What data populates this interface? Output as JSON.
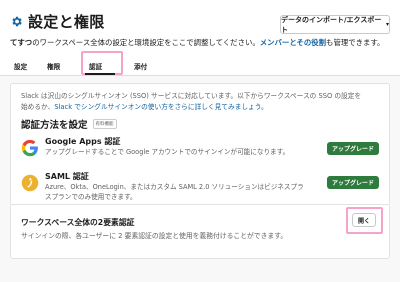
{
  "header": {
    "title": "設定と権限",
    "export_label": "データのインポート/エクスポート",
    "subtitle_workspace": "てすつ",
    "subtitle_text": "のワークスペース全体の設定と環境設定をここで調整してください。",
    "subtitle_link": "メンバーとその役割",
    "subtitle_tail": "も管理できます。"
  },
  "tabs": [
    {
      "label": "設定"
    },
    {
      "label": "権限"
    },
    {
      "label": "認証"
    },
    {
      "label": "添付"
    }
  ],
  "auth": {
    "intro_line1": "Slack は沢山のシングルサインオン (SSO) サービスに対応しています。以下からワークスペースの SSO の設定を",
    "intro_line2_prefix": "始めるか、",
    "intro_link": "Slack でシングルサインオンの使い方をさらに詳しく見てみましょう",
    "intro_line2_suffix": "。",
    "section_title": "認証方法を設定",
    "paid_badge": "有料機能",
    "methods": [
      {
        "name": "Google Apps 認証",
        "desc": "アップグレードすることで Google アカウントでのサインインが可能になります。",
        "button": "アップグレード",
        "icon": "google-icon"
      },
      {
        "name": "SAML 認証",
        "desc": "Azure、Okta、OneLogin、またはカスタム SAML 2.0 ソリューションはビジネスプラスプランでのみ使用できます。",
        "button": "アップグレード",
        "icon": "saml-icon"
      }
    ]
  },
  "two_factor": {
    "title": "ワークスペース全体の2要素認証",
    "desc": "サインインの際、各ユーザーに 2 要素認証の設定と使用を義務付けることができます。",
    "open_label": "開く"
  },
  "colors": {
    "accent_green": "#2f7b3d",
    "link_blue": "#1264a3",
    "highlight_pink": "#f5a3c7"
  }
}
